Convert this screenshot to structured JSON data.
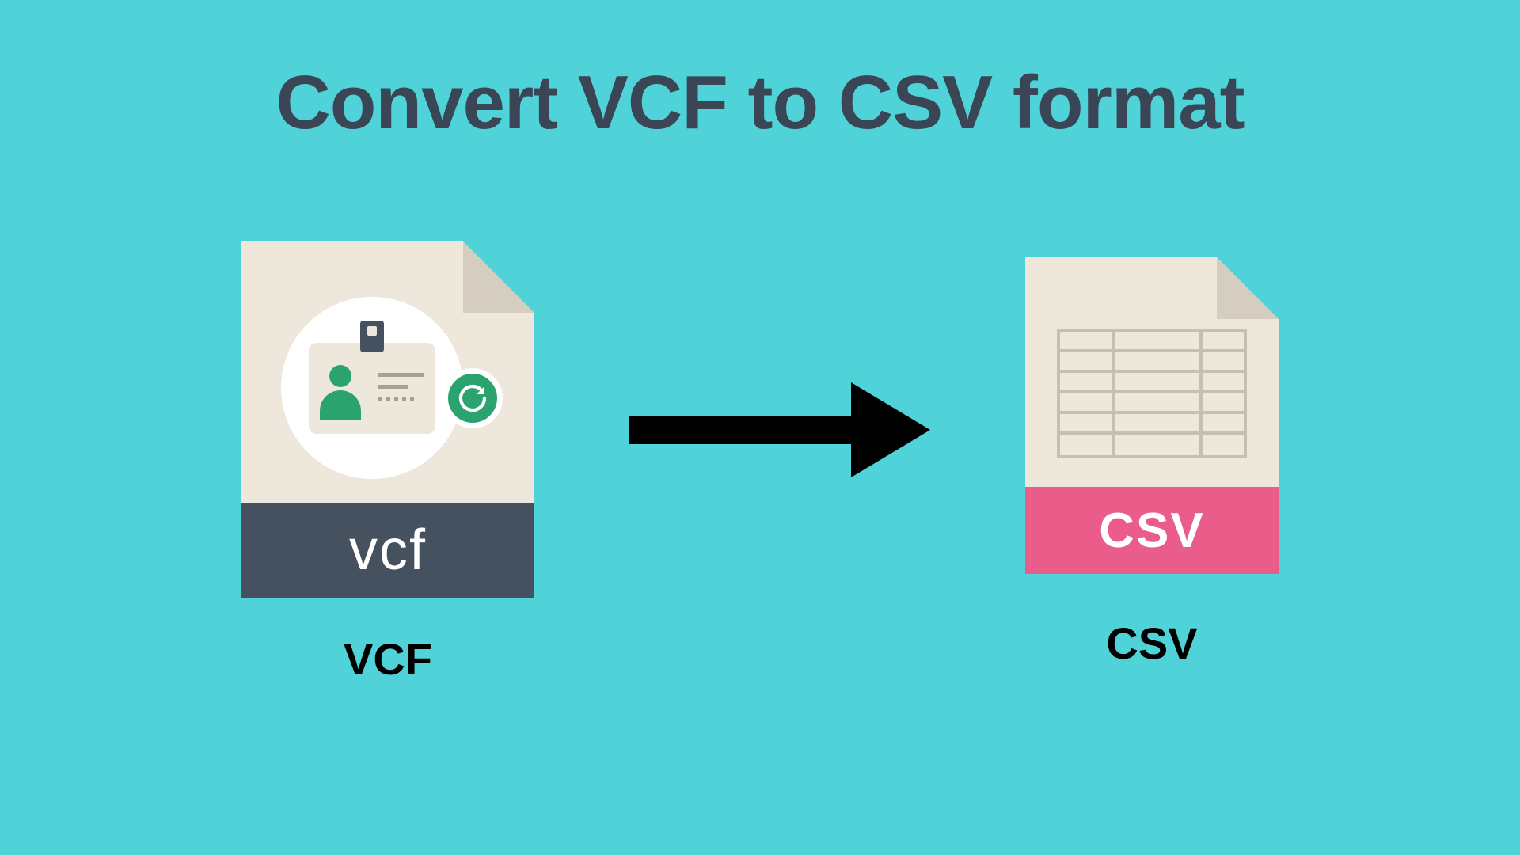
{
  "title": "Convert VCF to CSV format",
  "source": {
    "ext_label": "vcf",
    "caption": "VCF"
  },
  "target": {
    "ext_label": "CSV",
    "caption": "CSV"
  },
  "colors": {
    "background": "#4fd3d8",
    "title_text": "#3a4556",
    "vcf_footer": "#465160",
    "csv_footer": "#ea5c8a",
    "file_body": "#ede7dc",
    "accent_green": "#2ba36f",
    "arrow": "#000000"
  }
}
